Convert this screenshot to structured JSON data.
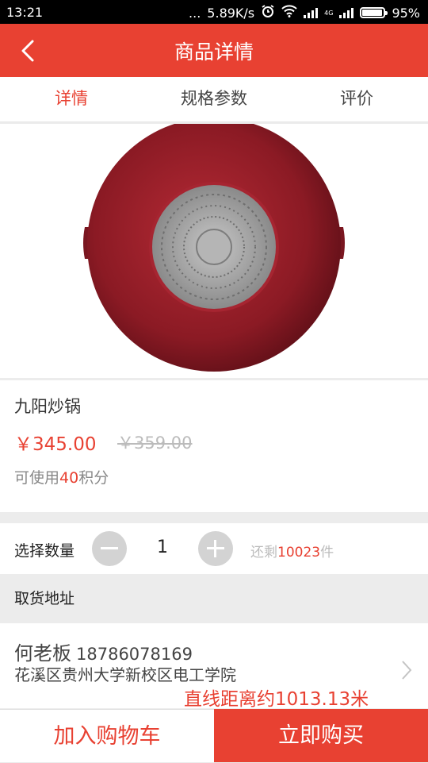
{
  "status_bar": {
    "time": "13:21",
    "dots": "...",
    "speed": "5.89K/s",
    "network": "4G",
    "battery": "95%",
    "battery_level": 0.95
  },
  "header": {
    "title": "商品详情"
  },
  "tabs": [
    {
      "label": "详情",
      "active": true
    },
    {
      "label": "规格参数",
      "active": false
    },
    {
      "label": "评价",
      "active": false
    }
  ],
  "product": {
    "name": "九阳炒锅",
    "price": "￥345.00",
    "original_price": "￥359.00",
    "points_prefix": "可使用",
    "points_value": "40",
    "points_suffix": "积分"
  },
  "quantity": {
    "label": "选择数量",
    "value": "1",
    "stock_prefix": "还剩",
    "stock_value": "10023",
    "stock_suffix": "件"
  },
  "pickup": {
    "label": "取货地址",
    "contact_name": "何老板",
    "phone": "18786078169",
    "address": "花溪区贵州大学新校区电工学院",
    "distance": "直线距离约1013.13米"
  },
  "actions": {
    "add_to_cart": "加入购物车",
    "buy_now": "立即购买"
  },
  "colors": {
    "accent": "#e84132",
    "pan": "#8b1a24",
    "background": "#ececec"
  }
}
